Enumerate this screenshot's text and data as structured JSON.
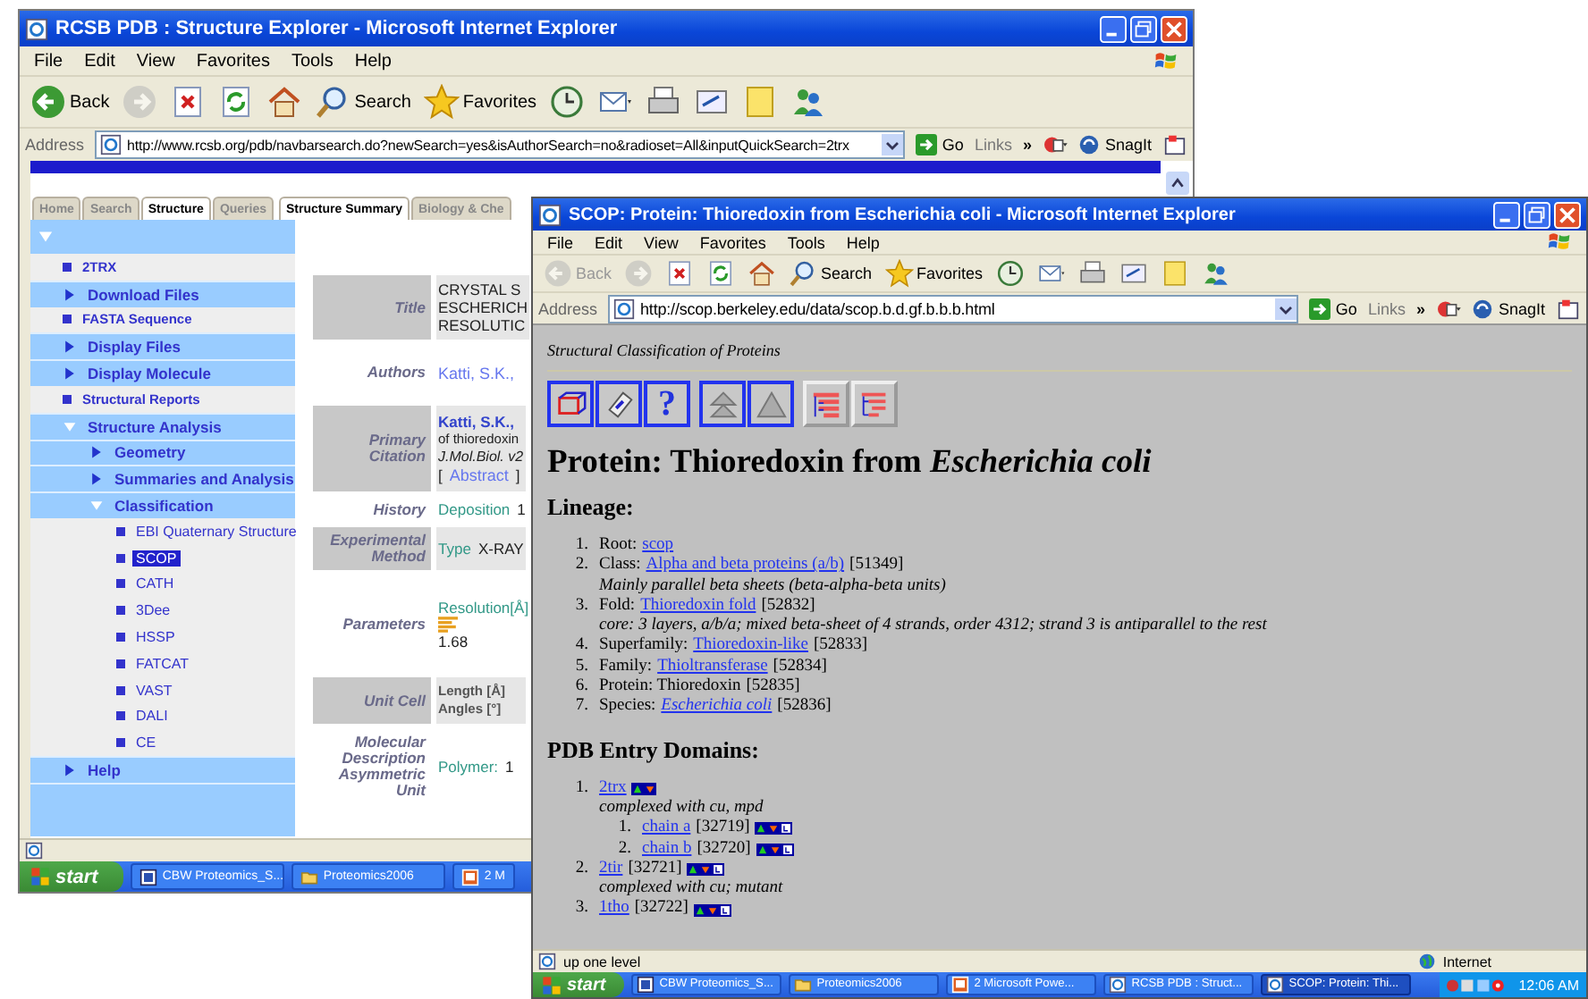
{
  "windows": [
    {
      "kind": "rcsb",
      "title": "RCSB PDB : Structure Explorer - Microsoft Internet Explorer",
      "menu": [
        "File",
        "Edit",
        "View",
        "Favorites",
        "Tools",
        "Help"
      ],
      "toolbar": [
        {
          "kind": "back",
          "label": "Back",
          "disabled": false
        },
        {
          "kind": "forward",
          "disabled": true
        },
        {
          "kind": "stop",
          "disabled": false
        },
        {
          "kind": "refresh",
          "disabled": false
        },
        {
          "kind": "home",
          "disabled": false
        },
        {
          "kind": "search",
          "label": "Search",
          "disabled": false
        },
        {
          "kind": "favorites",
          "label": "Favorites",
          "disabled": false
        },
        {
          "kind": "history",
          "disabled": false
        },
        {
          "kind": "mail",
          "disabled": false
        },
        {
          "kind": "print",
          "disabled": false
        },
        {
          "kind": "edit",
          "disabled": false
        },
        {
          "kind": "note",
          "disabled": false
        },
        {
          "kind": "messenger",
          "disabled": false
        }
      ],
      "address": {
        "label": "Address",
        "url": "http://www.rcsb.org/pdb/navbarsearch.do?newSearch=yes&isAuthorSearch=no&radioset=All&inputQuickSearch=2trx"
      },
      "go": "Go",
      "links": "Links",
      "chevron": "»",
      "snagit": "SnagIt",
      "nav_tabs": [
        {
          "label": "Home",
          "selected": false
        },
        {
          "label": "Search",
          "selected": false
        },
        {
          "label": "Structure",
          "selected": true
        },
        {
          "label": "Queries",
          "selected": false
        }
      ],
      "content_tabs": [
        {
          "label": "Structure Summary",
          "selected": true
        },
        {
          "label": "Biology & Che",
          "selected": false
        }
      ],
      "sidebar": [
        {
          "label": "2TRX",
          "kind": "leaf",
          "selected": false
        },
        {
          "label": "Download Files",
          "kind": "folder",
          "expanded": false,
          "selected": false
        },
        {
          "label": "FASTA Sequence",
          "kind": "leaf",
          "selected": false
        },
        {
          "label": "Display Files",
          "kind": "folder",
          "expanded": false,
          "selected": false
        },
        {
          "label": "Display Molecule",
          "kind": "folder",
          "expanded": false,
          "selected": false
        },
        {
          "label": "Structural Reports",
          "kind": "leaf",
          "selected": false
        },
        {
          "label": "Structure Analysis",
          "kind": "folder",
          "expanded": true,
          "selected": false,
          "children": [
            {
              "label": "Geometry",
              "kind": "folder",
              "expanded": false,
              "selected": false
            },
            {
              "label": "Summaries and Analysis",
              "kind": "folder",
              "expanded": false,
              "selected": false
            },
            {
              "label": "Classification",
              "kind": "folder",
              "expanded": true,
              "selected": false,
              "children": [
                {
                  "label": "EBI Quaternary Structure",
                  "kind": "leaf",
                  "selected": false
                },
                {
                  "label": "SCOP",
                  "kind": "leaf",
                  "selected": true
                },
                {
                  "label": "CATH",
                  "kind": "leaf",
                  "selected": false
                },
                {
                  "label": "3Dee",
                  "kind": "leaf",
                  "selected": false
                },
                {
                  "label": "HSSP",
                  "kind": "leaf",
                  "selected": false
                },
                {
                  "label": "FATCAT",
                  "kind": "leaf",
                  "selected": false
                },
                {
                  "label": "VAST",
                  "kind": "leaf",
                  "selected": false
                },
                {
                  "label": "DALI",
                  "kind": "leaf",
                  "selected": false
                },
                {
                  "label": "CE",
                  "kind": "leaf",
                  "selected": false
                }
              ]
            }
          ]
        },
        {
          "label": "Help",
          "kind": "folder",
          "expanded": false,
          "selected": false
        }
      ],
      "summary": [
        {
          "label": "Title",
          "lines": [
            [
              {
                "kind": "plain",
                "text": "CRYSTAL S"
              }
            ],
            [
              {
                "kind": "plain",
                "text": "ESCHERICH"
              }
            ],
            [
              {
                "kind": "plain",
                "text": "RESOLUTIC"
              }
            ]
          ]
        },
        {
          "label": "Authors",
          "lines": [
            [
              {
                "kind": "link",
                "text": "Katti, S.K.,"
              }
            ]
          ]
        },
        {
          "label": "Primary Citation",
          "lines": [
            [
              {
                "kind": "strong-link",
                "text": "Katti, S.K.,"
              }
            ],
            [
              {
                "kind": "small",
                "text": "of thioredoxin"
              }
            ],
            [
              {
                "kind": "journal",
                "text": "J.Mol.Biol.  v2"
              }
            ],
            [
              {
                "kind": "plain",
                "text": "["
              },
              {
                "kind": "link",
                "text": "Abstract"
              },
              {
                "kind": "plain",
                "text": "]"
              }
            ]
          ]
        },
        {
          "label": "History",
          "lines": [
            [
              {
                "kind": "key",
                "text": "Deposition"
              },
              {
                "kind": "plain",
                "text": "1"
              }
            ]
          ]
        },
        {
          "label": "Experimental Method",
          "lines": [
            [
              {
                "kind": "key",
                "text": "Type"
              },
              {
                "kind": "plain",
                "text": "X-RAY"
              }
            ]
          ]
        },
        {
          "label": "Parameters",
          "lines": [
            [
              {
                "kind": "key",
                "text": "Resolution[Å]"
              }
            ],
            [
              {
                "kind": "bars"
              }
            ],
            [
              {
                "kind": "plain",
                "text": "1.68"
              }
            ]
          ]
        },
        {
          "label": "Unit Cell",
          "lines": [
            [
              {
                "kind": "heading",
                "text": "Length [Å]"
              }
            ],
            [
              {
                "kind": "heading",
                "text": "Angles [°]"
              }
            ]
          ]
        },
        {
          "label": "Molecular Description Asymmetric Unit",
          "lines": [
            [
              {
                "kind": "key",
                "text": "Polymer:"
              },
              {
                "kind": "plain",
                "text": "1"
              }
            ]
          ]
        }
      ],
      "taskbar": {
        "start": "start",
        "tasks": [
          {
            "label": "CBW Proteomics_S...",
            "kind": "document",
            "selected": false
          },
          {
            "label": "Proteomics2006",
            "kind": "folder",
            "selected": false
          },
          {
            "label": "2 M",
            "kind": "slides",
            "selected": false
          }
        ]
      }
    },
    {
      "kind": "scop",
      "title": "SCOP: Protein: Thioredoxin from Escherichia coli - Microsoft Internet Explorer",
      "menu": [
        "File",
        "Edit",
        "View",
        "Favorites",
        "Tools",
        "Help"
      ],
      "toolbar": [
        {
          "kind": "back",
          "label": "Back",
          "disabled": true
        },
        {
          "kind": "forward",
          "disabled": true
        },
        {
          "kind": "stop",
          "disabled": false
        },
        {
          "kind": "refresh",
          "disabled": false
        },
        {
          "kind": "home",
          "disabled": false
        },
        {
          "kind": "search",
          "label": "Search",
          "disabled": false
        },
        {
          "kind": "favorites",
          "label": "Favorites",
          "disabled": false
        },
        {
          "kind": "history",
          "disabled": false
        },
        {
          "kind": "mail",
          "disabled": false
        },
        {
          "kind": "print",
          "disabled": false
        },
        {
          "kind": "edit",
          "disabled": false
        },
        {
          "kind": "note",
          "disabled": false
        },
        {
          "kind": "messenger",
          "disabled": false
        }
      ],
      "address": {
        "label": "Address",
        "url": "http://scop.berkeley.edu/data/scop.b.d.gf.b.b.b.html"
      },
      "go": "Go",
      "links": "Links",
      "chevron": "»",
      "snagit": "SnagIt",
      "subtitle": "Structural Classification of Proteins",
      "nav_buttons": [
        {
          "kind": "cube",
          "framed": true
        },
        {
          "kind": "tag",
          "framed": true
        },
        {
          "kind": "help",
          "glyph": "?",
          "framed": true
        },
        {
          "kind": "up-top",
          "framed": true
        },
        {
          "kind": "up",
          "framed": true
        },
        {
          "kind": "tree-full",
          "framed": false
        },
        {
          "kind": "tree",
          "framed": false
        }
      ],
      "heading": "Protein: Thioredoxin from *Escherichia coli*",
      "lineage_title": "Lineage:",
      "lineage": [
        {
          "num": "1.",
          "label": "Root:",
          "link": "scop"
        },
        {
          "num": "2.",
          "label": "Class:",
          "link": "Alpha and beta proteins (a/b)",
          "id": "[51349]",
          "note": "Mainly parallel beta sheets (beta-alpha-beta units)"
        },
        {
          "num": "3.",
          "label": "Fold:",
          "link": "Thioredoxin fold",
          "id": "[52832]",
          "note": "core: 3 layers, a/b/a; mixed beta-sheet of 4 strands, order 4312; strand 3 is antiparallel to the rest"
        },
        {
          "num": "4.",
          "label": "Superfamily:",
          "link": "Thioredoxin-like",
          "id": "[52833]"
        },
        {
          "num": "5.",
          "label": "Family:",
          "link": "Thioltransferase",
          "id": "[52834]"
        },
        {
          "num": "6.",
          "label": "Protein: Thioredoxin",
          "id": "[52835]"
        },
        {
          "num": "7.",
          "label": "Species:",
          "link": "*Escherichia coli*",
          "id": "[52836]"
        }
      ],
      "domains_title": "PDB Entry Domains:",
      "domains": [
        {
          "num": "1.",
          "link": "2trx",
          "list_icon": false,
          "note": "complexed with cu, mpd",
          "children": [
            {
              "num": "1.",
              "link": "chain a",
              "id": "[32719]",
              "list_icon": true
            },
            {
              "num": "2.",
              "link": "chain b",
              "id": "[32720]",
              "list_icon": true
            }
          ]
        },
        {
          "num": "2.",
          "link": "2tir",
          "id": "[32721]",
          "list_icon": true,
          "note": "complexed with cu; mutant"
        },
        {
          "num": "3.",
          "link": "1tho",
          "id": "[32722]",
          "list_icon": true
        }
      ],
      "status": {
        "text": "up one level",
        "zone": "Internet"
      },
      "taskbar": {
        "start": "start",
        "tasks": [
          {
            "label": "CBW Proteomics_S...",
            "kind": "document",
            "selected": false
          },
          {
            "label": "Proteomics2006",
            "kind": "folder",
            "selected": false
          },
          {
            "label": "2 Microsoft Powe...",
            "kind": "slides",
            "selected": false
          },
          {
            "label": "RCSB PDB : Struct...",
            "kind": "browser",
            "selected": false
          },
          {
            "label": "SCOP: Protein: Thi...",
            "kind": "browser",
            "selected": true
          }
        ],
        "clock": "12:06 AM"
      }
    }
  ]
}
